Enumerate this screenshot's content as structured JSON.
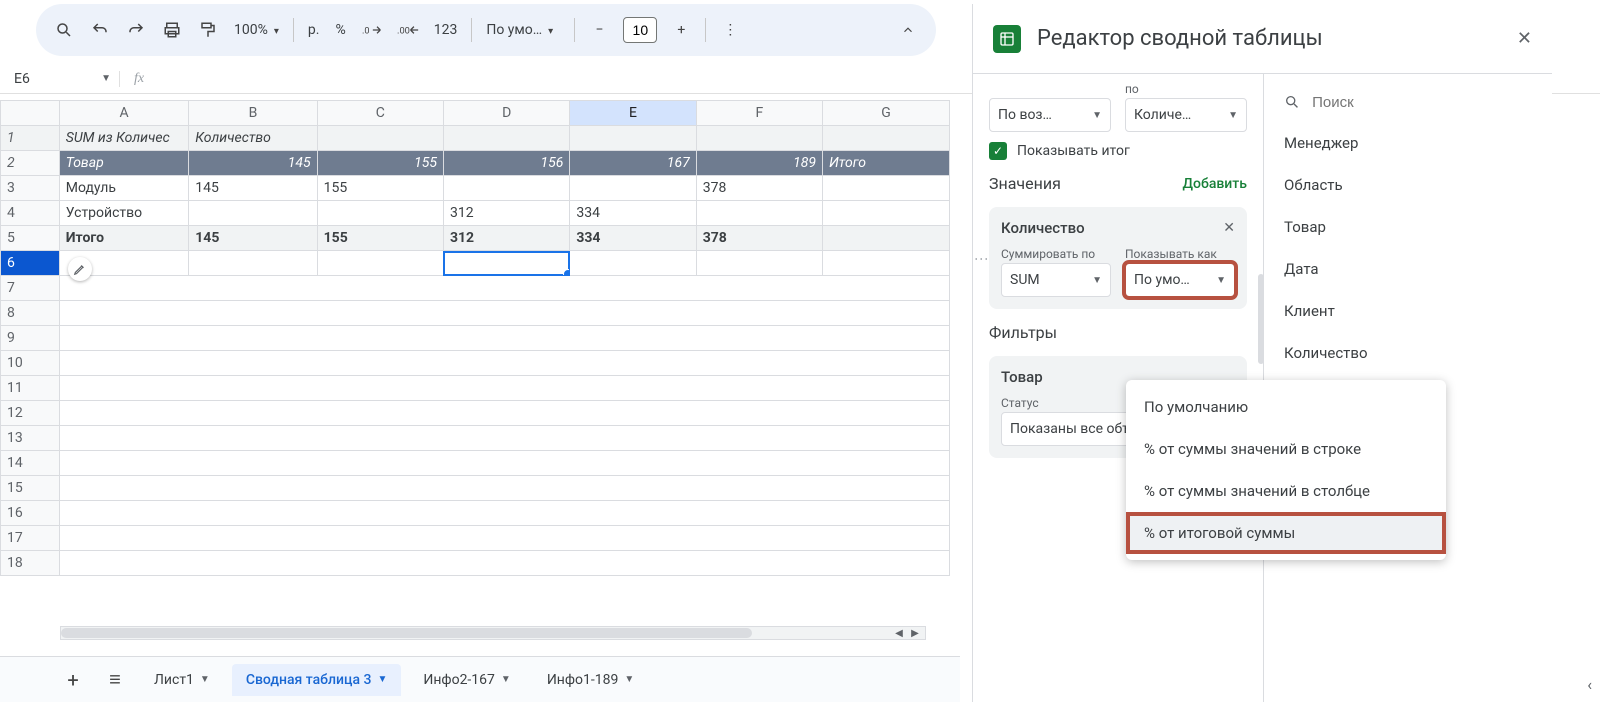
{
  "toolbar": {
    "zoom": "100%",
    "currency": "р.",
    "percent": "%",
    "numfmt": "123",
    "font": "По умо…",
    "fontsize": "10"
  },
  "namebox": "E6",
  "columns": [
    "A",
    "B",
    "C",
    "D",
    "E",
    "F",
    "G"
  ],
  "rows": {
    "count": 18,
    "r1": {
      "a": "SUM из Количес",
      "b": "Количество"
    },
    "r2": {
      "a": "Товар",
      "b": "145",
      "c": "155",
      "d": "156",
      "e": "167",
      "f": "189",
      "g": "Итого"
    },
    "r3": {
      "a": "Модуль",
      "b": "145",
      "c": "155",
      "f": "378"
    },
    "r4": {
      "a": "Устройство",
      "d": "312",
      "e": "334"
    },
    "r5": {
      "a": "Итого",
      "b": "145",
      "c": "155",
      "d": "312",
      "e": "334",
      "f": "378"
    }
  },
  "sheettabs": {
    "t1": "Лист1",
    "t2": "Сводная таблица 3",
    "t3": "Инфо2-167",
    "t4": "Инфо1-189"
  },
  "panel": {
    "title": "Редактор сводной таблицы",
    "rows_section": {
      "sort_label": "По воз…",
      "sort2_label_top": "по",
      "sort2_label": "Количе…",
      "show_total": "Показывать итог"
    },
    "values_section": {
      "title": "Значения",
      "add": "Добавить",
      "card_title": "Количество",
      "sum_label": "Суммировать по",
      "sum_val": "SUM",
      "show_label": "Показывать как",
      "show_val": "По умо…"
    },
    "filters_section": {
      "title": "Фильтры",
      "card_title": "Товар",
      "status_label": "Статус",
      "status_val": "Показаны все объекты"
    },
    "search_placeholder": "Поиск",
    "fields": {
      "f1": "Менеджер",
      "f2": "Область",
      "f3": "Товар",
      "f4": "Дата",
      "f5": "Клиент",
      "f6": "Количество"
    }
  },
  "menu": {
    "m1": "По умолчанию",
    "m2": "% от суммы значений в строке",
    "m3": "% от суммы значений в столбце",
    "m4": "% от итоговой суммы"
  }
}
